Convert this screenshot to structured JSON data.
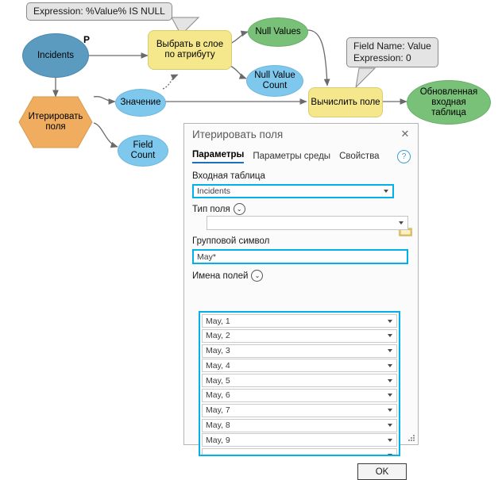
{
  "diagram": {
    "nodes": [
      {
        "id": "incidents",
        "label": "Incidents",
        "type": "data-ellipse-blue"
      },
      {
        "id": "iterate",
        "label": "Итерировать\nполя",
        "type": "iterator-hexagon"
      },
      {
        "id": "select-layer",
        "label": "Выбрать в слое\nпо атрибуту",
        "type": "tool-box-yellow"
      },
      {
        "id": "value",
        "label": "Значение",
        "type": "variable-ellipse-lightblue"
      },
      {
        "id": "field-count",
        "label": "Field\nCount",
        "type": "variable-ellipse-lightblue"
      },
      {
        "id": "null-values",
        "label": "Null Values",
        "type": "output-ellipse-green"
      },
      {
        "id": "null-count",
        "label": "Null Value\nCount",
        "type": "variable-ellipse-lightblue"
      },
      {
        "id": "calc-field",
        "label": "Вычислить поле",
        "type": "tool-box-yellow"
      },
      {
        "id": "updated",
        "label": "Обновленная\nвходная\nтаблица",
        "type": "output-ellipse-green"
      }
    ],
    "precondition_label": "P",
    "callouts": [
      {
        "id": "select-callout",
        "text": "Expression: %Value% IS NULL"
      },
      {
        "id": "calc-callout",
        "text": "Field Name: Value\nExpression: 0"
      }
    ],
    "colors": {
      "data_blue": "#5b9bc0",
      "variable_light_blue": "#7ec8ee",
      "output_green": "#79c079",
      "tool_yellow": "#f5e78c",
      "iterator_orange": "#f0ad60",
      "callout_gray": "#e4e4e4",
      "connector": "#6a6a6a"
    }
  },
  "dialog": {
    "title": "Итерировать поля",
    "close_label": "✕",
    "help_label": "?",
    "tabs": [
      {
        "id": "parameters",
        "label": "Параметры",
        "active": true
      },
      {
        "id": "environment",
        "label": "Параметры среды",
        "active": false
      },
      {
        "id": "properties",
        "label": "Свойства",
        "active": false
      }
    ],
    "fields": {
      "input_table": {
        "label": "Входная таблица",
        "value": "Incidents",
        "placeholder": ""
      },
      "field_type": {
        "label": "Тип поля",
        "value": "",
        "placeholder": ""
      },
      "wildcard": {
        "label": "Групповой символ",
        "value": "May*",
        "placeholder": ""
      },
      "field_names": {
        "label": "Имена полей",
        "values": [
          "May, 1",
          "May, 2",
          "May, 3",
          "May, 4",
          "May, 5",
          "May, 6",
          "May, 7",
          "May, 8",
          "May, 9",
          ""
        ]
      }
    },
    "ok_label": "OK",
    "accent_color": "#00b2e8",
    "tab_underline_color": "#1b6ec2"
  }
}
